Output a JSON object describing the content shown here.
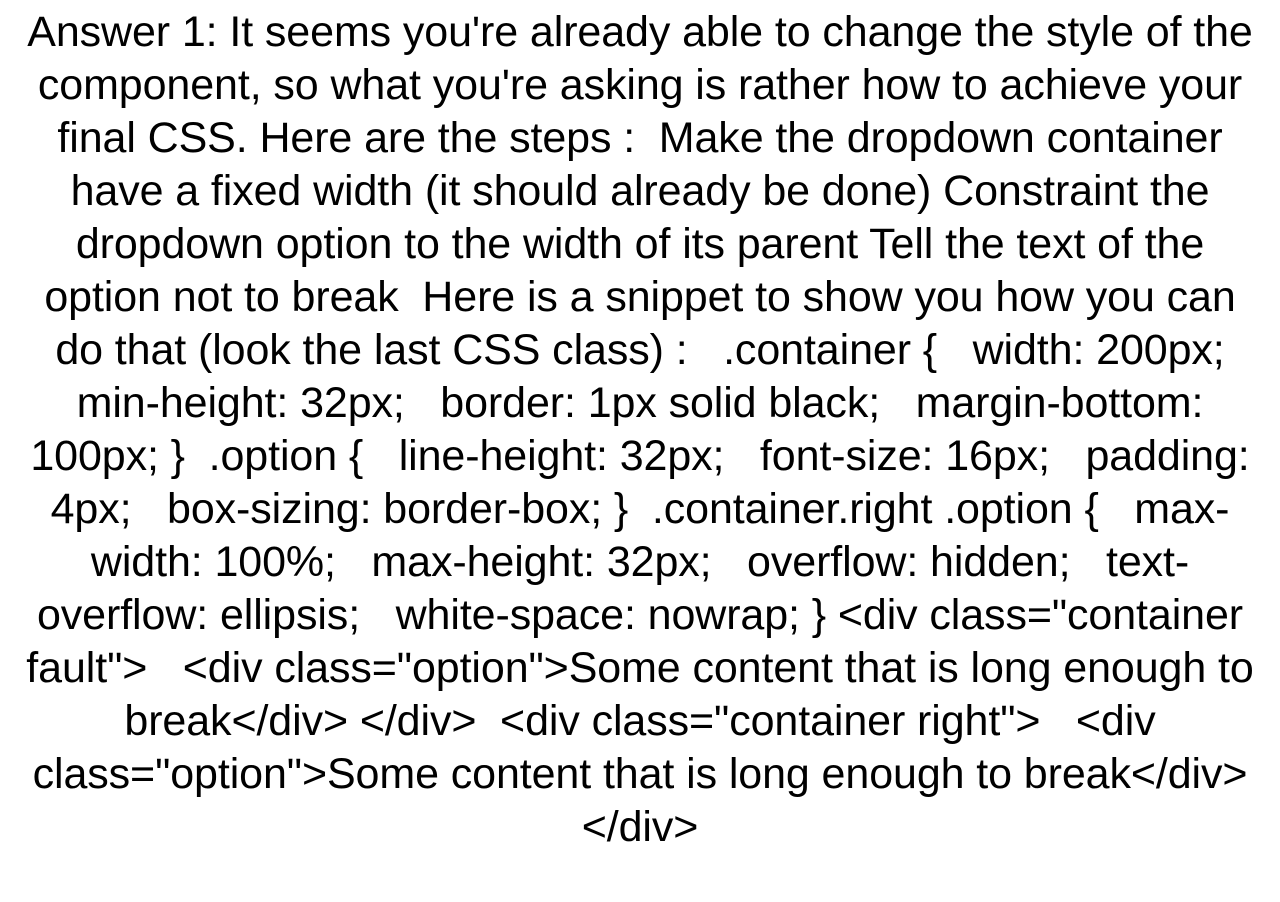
{
  "document": {
    "background_color": "#ffffff",
    "text_color": "#000000",
    "alignment": "center",
    "answer": {
      "label": "Answer 1:",
      "full_text": "Answer 1: It seems you're already able to change the style of the component, so what you're asking is rather how to achieve your final CSS. Here are the steps :  Make the dropdown container have a fixed width (it should already be done) Constraint the dropdown option to the width of its parent Tell the text of the option not to break  Here is a snippet to show you how you can do that (look the last CSS class) :   .container {   width: 200px;   min-height: 32px;   border: 1px solid black;   margin-bottom: 100px; }  .option {   line-height: 32px;   font-size: 16px;   padding: 4px;   box-sizing: border-box; }  .container.right .option {   max-width: 100%;   max-height: 32px;   overflow: hidden;   text-overflow: ellipsis;   white-space: nowrap; } <div class=\"container fault\">   <div class=\"option\">Some content that is long enough to break</div> </div>  <div class=\"container right\">   <div class=\"option\">Some content that is long enough to break</div> </div>",
      "intro_sentences": [
        "It seems you're already able to change the style of the component, so what you're asking is rather how to achieve your final CSS.",
        "Here are the steps :"
      ],
      "steps": [
        "Make the dropdown container have a fixed width (it should already be done)",
        "Constraint the dropdown option to the width of its parent",
        "Tell the text of the option not to break"
      ],
      "snippet_lead": "Here is a snippet to show you how you can do that (look the last CSS class) :",
      "css_rules": [
        {
          "selector": ".container",
          "declarations": [
            "width: 200px;",
            "min-height: 32px;",
            "border: 1px solid black;",
            "margin-bottom: 100px;"
          ]
        },
        {
          "selector": ".option",
          "declarations": [
            "line-height: 32px;",
            "font-size: 16px;",
            "padding: 4px;",
            "box-sizing: border-box;"
          ]
        },
        {
          "selector": ".container.right .option",
          "declarations": [
            "max-width: 100%;",
            "max-height: 32px;",
            "overflow: hidden;",
            "text-overflow: ellipsis;",
            "white-space: nowrap;"
          ]
        }
      ],
      "html_markup": [
        "<div class=\"container fault\">",
        "<div class=\"option\">Some content that is long enough to break</div>",
        "</div>",
        "<div class=\"container right\">",
        "<div class=\"option\">Some content that is long enough to break</div>",
        "</div>"
      ],
      "rendered_lines": [
        "Answer 1: It seems you're already able to change the style",
        "of the component, so what you're asking is rather how to",
        "achieve your final CSS. Here are the steps :  Make the",
        "dropdown container have a fixed width (it should already be",
        "done) Constraint the dropdown option to the width of its",
        "parent Tell the text of the option not to break  Here is a",
        "snippet to show you how you can do that (look the last CSS",
        "class) :   .container {   width: 200px;   min-height: 32px;",
        "border: 1px solid black;   margin-bottom: 100px; }  .option",
        "{   line-height: 32px;   font-size: 16px;   padding: 4px;",
        "box-sizing: border-box; }  .container.right .option {   max-",
        "width: 100%;   max-height: 32px;   overflow: hidden;   text-",
        "overflow: ellipsis;   white-space: nowrap; } <div",
        "class=\"container fault\">   <div class=\"option\">Some content",
        "that is long enough to break</div> </div>  <div",
        "class=\"container right\">   <div class=\"option\">Some content",
        "that is long enough to break</div> </div>"
      ],
      "line_count": 17
    }
  }
}
